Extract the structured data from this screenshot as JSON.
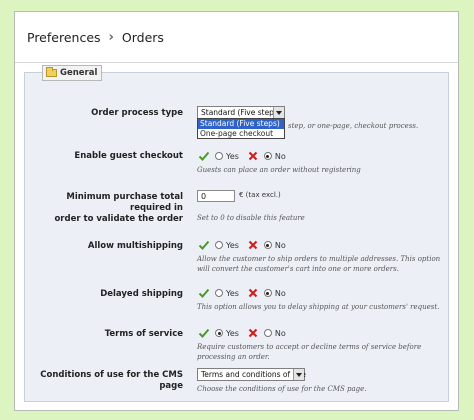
{
  "breadcrumb": {
    "parent": "Preferences",
    "separator": "›",
    "current": "Orders"
  },
  "fieldset": {
    "legend": "General",
    "legend_icon": "folder-icon"
  },
  "fields": {
    "order_process": {
      "label": "Order process type",
      "selected": "Standard (Five steps)",
      "options": [
        "Standard (Five steps)",
        "One-page checkout"
      ],
      "help_visible": "step, or one-page, checkout process."
    },
    "guest_checkout": {
      "label": "Enable guest checkout",
      "yes": "Yes",
      "no": "No",
      "value": "No",
      "help": "Guests can place an order without registering"
    },
    "minimum_purchase": {
      "label_line1": "Minimum purchase total required in",
      "label_line2": "order to validate the order",
      "value": "0",
      "suffix": "€ (tax excl.)",
      "help": "Set to 0 to disable this feature"
    },
    "multishipping": {
      "label": "Allow multishipping",
      "yes": "Yes",
      "no": "No",
      "value": "No",
      "help": "Allow the customer to ship orders to multiple addresses. This option will convert the customer's cart into one or more orders."
    },
    "delayed_shipping": {
      "label": "Delayed shipping",
      "yes": "Yes",
      "no": "No",
      "value": "No",
      "help": "This option allows you to delay shipping at your customers' request."
    },
    "terms_of_service": {
      "label": "Terms of service",
      "yes": "Yes",
      "no": "No",
      "value": "Yes",
      "help": "Require customers to accept or decline terms of service before processing an order."
    },
    "cms_conditions": {
      "label": "Conditions of use for the CMS page",
      "selected": "Terms and conditions of use",
      "help": "Choose the conditions of use for the CMS page."
    }
  },
  "colors": {
    "page_bg": "#dcf5c0",
    "fieldset_bg": "#ecf0f6",
    "yes_check": "#4a9a2a",
    "no_cross": "#d02020",
    "dropdown_highlight": "#2f63c8"
  }
}
